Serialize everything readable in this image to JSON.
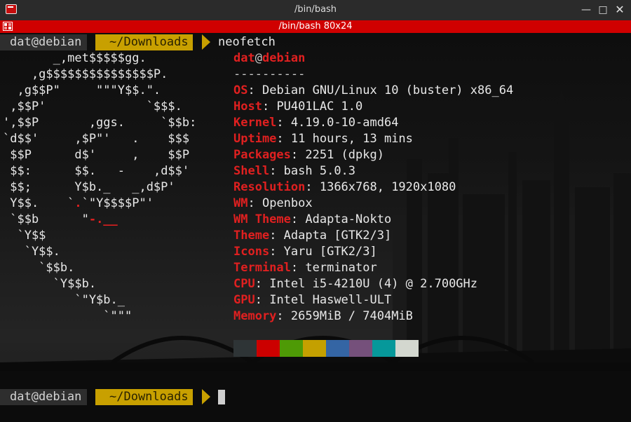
{
  "window": {
    "title": "/bin/bash",
    "minimize_icon": "minimize-icon",
    "maximize_icon": "maximize-icon",
    "close_icon": "close-icon",
    "app_icon": "terminal-app-icon"
  },
  "terminal_bar": {
    "title": "/bin/bash 80x24",
    "icon": "grid-icon"
  },
  "prompt1": {
    "user": "dat@debian",
    "dir": "~/Downloads",
    "command": "neofetch"
  },
  "prompt2": {
    "user": "dat@debian",
    "dir": "~/Downloads",
    "command": ""
  },
  "ascii_logo": [
    "       _,met$$$$$gg.",
    "    ,g$$$$$$$$$$$$$$$P.",
    "  ,g$$P\"     \"\"\"Y$$.\".",
    " ,$$P'              `$$$.",
    "',$$P       ,ggs.     `$$b:",
    "`d$$'     ,$P\"'   .    $$$",
    " $$P      d$'     ,    $$P",
    " $$:      $$.   -    ,d$$'",
    " $$;      Y$b._   _,d$P'",
    " Y$$.    `.`\"Y$$$$P\"'",
    " `$$b      \"-.__",
    "  `Y$$",
    "   `Y$$.",
    "     `$$b.",
    "       `Y$$b.",
    "          `\"Y$b._",
    "              `\"\"\""
  ],
  "sysinfo": {
    "user": "dat",
    "at": "@",
    "host": "debian",
    "separator": "----------",
    "rows": [
      {
        "key": "OS",
        "value": "Debian GNU/Linux 10 (buster) x86_64"
      },
      {
        "key": "Host",
        "value": "PU401LAC 1.0"
      },
      {
        "key": "Kernel",
        "value": "4.19.0-10-amd64"
      },
      {
        "key": "Uptime",
        "value": "11 hours, 13 mins"
      },
      {
        "key": "Packages",
        "value": "2251 (dpkg)"
      },
      {
        "key": "Shell",
        "value": "bash 5.0.3"
      },
      {
        "key": "Resolution",
        "value": "1366x768, 1920x1080"
      },
      {
        "key": "WM",
        "value": "Openbox"
      },
      {
        "key": "WM Theme",
        "value": "Adapta-Nokto"
      },
      {
        "key": "Theme",
        "value": "Adapta [GTK2/3]"
      },
      {
        "key": "Icons",
        "value": "Yaru [GTK2/3]"
      },
      {
        "key": "Terminal",
        "value": "terminator"
      },
      {
        "key": "CPU",
        "value": "Intel i5-4210U (4) @ 2.700GHz"
      },
      {
        "key": "GPU",
        "value": "Intel Haswell-ULT"
      },
      {
        "key": "Memory",
        "value": "2659MiB / 7404MiB"
      }
    ]
  },
  "palette": [
    "#2e3436",
    "#cc0000",
    "#4e9a06",
    "#c4a000",
    "#3465a4",
    "#75507b",
    "#06989a",
    "#d3d7cf"
  ],
  "colors": {
    "accent_red": "#d00000",
    "prompt_user_bg": "#2e2e2e",
    "prompt_dir_bg": "#c8a000",
    "text": "#e8e8e8"
  }
}
